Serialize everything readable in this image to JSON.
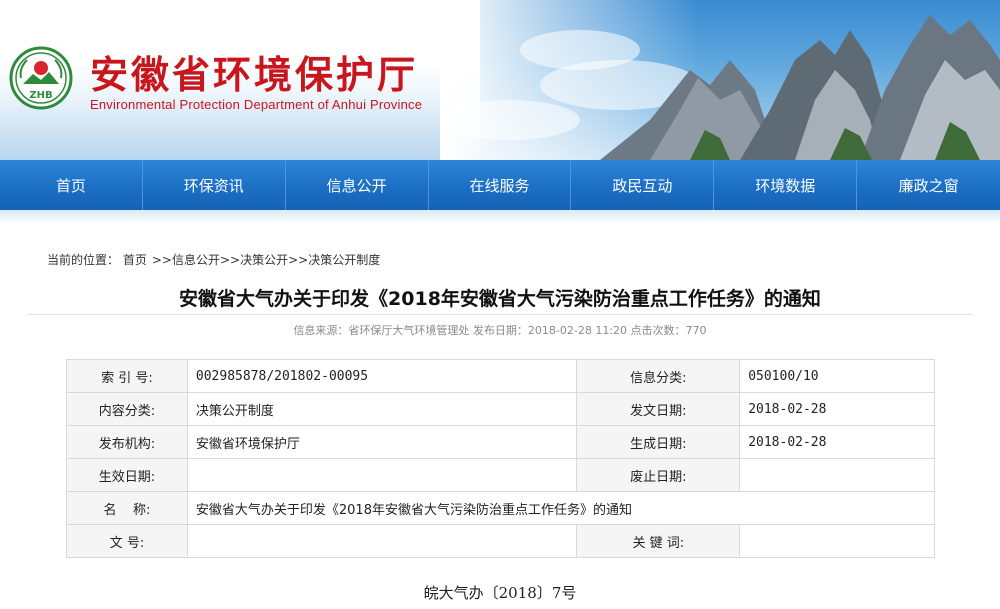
{
  "header": {
    "title": "安徽省环境保护厅",
    "subtitle": "Environmental Protection Department of Anhui Province",
    "logo_text": "ZHB",
    "brand_color": "#c8161d"
  },
  "nav": {
    "items": [
      "首页",
      "环保资讯",
      "信息公开",
      "在线服务",
      "政民互动",
      "环境数据",
      "廉政之窗"
    ],
    "bar_color": "#1b6fc4"
  },
  "breadcrumb": {
    "prefix": "当前的位置：",
    "items": [
      "首页",
      "信息公开",
      "决策公开",
      "决策公开制度"
    ],
    "separator": ">>"
  },
  "article": {
    "title": "安徽省大气办关于印发《2018年安徽省大气污染防治重点工作任务》的通知",
    "meta": "信息来源：省环保厅大气环境管理处 发布日期：2018-02-28 11:20 点击次数：770"
  },
  "info_table": {
    "index_label": "索 引 号:",
    "index_value": "002985878/201802-00095",
    "category_label": "信息分类:",
    "category_value": "050100/10",
    "content_type_label": "内容分类:",
    "content_type_value": "决策公开制度",
    "issue_date_label": "发文日期:",
    "issue_date_value": "2018-02-28",
    "publisher_label": "发布机构:",
    "publisher_value": "安徽省环境保护厅",
    "created_date_label": "生成日期:",
    "created_date_value": "2018-02-28",
    "effective_date_label": "生效日期:",
    "effective_date_value": "",
    "expiry_date_label": "废止日期:",
    "expiry_date_value": "",
    "name_label": "名    称:",
    "name_value": "安徽省大气办关于印发《2018年安徽省大气污染防治重点工作任务》的通知",
    "doc_no_label": "文 号:",
    "doc_no_value": "",
    "keywords_label": "关 键 词:",
    "keywords_value": ""
  },
  "document": {
    "number": "皖大气办〔2018〕7号"
  }
}
